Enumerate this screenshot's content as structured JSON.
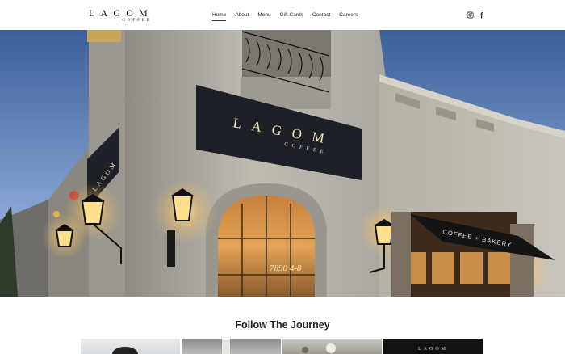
{
  "brand": {
    "logo_main": "LAGOM",
    "logo_sub": "COFFEE"
  },
  "nav": {
    "items": [
      {
        "label": "Home",
        "active": true
      },
      {
        "label": "About",
        "active": false
      },
      {
        "label": "Menu",
        "active": false
      },
      {
        "label": "Gift Cards",
        "active": false
      },
      {
        "label": "Contact",
        "active": false
      },
      {
        "label": "Careers",
        "active": false
      }
    ]
  },
  "social": {
    "icons": [
      "instagram-icon",
      "facebook-icon"
    ]
  },
  "hero": {
    "sign_main": "LAGOM",
    "sign_sub": "COFFEE",
    "awning_text": "COFFEE + BAKERY",
    "address": "7890 4-8"
  },
  "follow": {
    "title": "Follow The Journey",
    "thumb_logo": "LAGOM"
  },
  "colors": {
    "sky_top": "#3a5f9a",
    "sky_bottom": "#a9c2e4",
    "building": "#b8b4aa",
    "sign": "#1c1f26",
    "sign_text": "#f2e6b8",
    "warm_light": "#ffcf7a"
  }
}
